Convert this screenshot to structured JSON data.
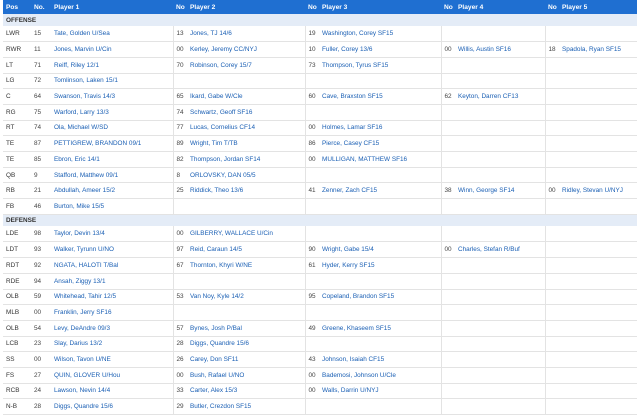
{
  "headers": [
    "Pos",
    "No.",
    "Player 1",
    "No",
    "Player 2",
    "No",
    "Player 3",
    "No",
    "Player 4",
    "No",
    "Player 5"
  ],
  "offense_label": "OFFENSE",
  "defense_label": "DEFENSE",
  "offense": [
    {
      "pos": "LWR",
      "n1": "15",
      "p1": "Tate, Golden U/Sea",
      "n2": "13",
      "p2": "Jones, TJ 14/6",
      "n3": "19",
      "p3": "Washington, Corey SF15",
      "n4": "",
      "p4": "",
      "n5": "",
      "p5": ""
    },
    {
      "pos": "RWR",
      "n1": "11",
      "p1": "Jones, Marvin U/Cin",
      "n2": "00",
      "p2": "Kerley, Jeremy CC/NYJ",
      "n3": "10",
      "p3": "Fuller, Corey 13/6",
      "n4": "00",
      "p4": "Willis, Austin SF16",
      "n5": "18",
      "p5": "Spadola, Ryan SF15"
    },
    {
      "pos": "LT",
      "n1": "71",
      "p1": "Reiff, Riley 12/1",
      "n2": "70",
      "p2": "Robinson, Corey 15/7",
      "n3": "73",
      "p3": "Thompson, Tyrus SF15",
      "n4": "",
      "p4": "",
      "n5": "",
      "p5": ""
    },
    {
      "pos": "LG",
      "n1": "72",
      "p1": "Tomlinson, Laken 15/1",
      "n2": "",
      "p2": "",
      "n3": "",
      "p3": "",
      "n4": "",
      "p4": "",
      "n5": "",
      "p5": ""
    },
    {
      "pos": "C",
      "n1": "64",
      "p1": "Swanson, Travis 14/3",
      "n2": "65",
      "p2": "Ikard, Gabe W/Cle",
      "n3": "60",
      "p3": "Cave, Braxston SF15",
      "n4": "62",
      "p4": "Keyton, Darren CF13",
      "n5": "",
      "p5": ""
    },
    {
      "pos": "RG",
      "n1": "75",
      "p1": "Warford, Larry 13/3",
      "n2": "74",
      "p2": "Schwartz, Geoff SF16",
      "n3": "",
      "p3": "",
      "n4": "",
      "p4": "",
      "n5": "",
      "p5": ""
    },
    {
      "pos": "RT",
      "n1": "74",
      "p1": "Ola, Michael W/SD",
      "n2": "77",
      "p2": "Lucas, Cornelius CF14",
      "n3": "00",
      "p3": "Holmes, Lamar SF16",
      "n4": "",
      "p4": "",
      "n5": "",
      "p5": ""
    },
    {
      "pos": "TE",
      "n1": "87",
      "p1": "PETTIGREW, BRANDON 09/1",
      "n2": "89",
      "p2": "Wright, Tim T/TB",
      "n3": "86",
      "p3": "Pierce, Casey CF15",
      "n4": "",
      "p4": "",
      "n5": "",
      "p5": ""
    },
    {
      "pos": "TE",
      "n1": "85",
      "p1": "Ebron, Eric 14/1",
      "n2": "82",
      "p2": "Thompson, Jordan SF14",
      "n3": "00",
      "p3": "MULLIGAN, MATTHEW SF16",
      "n4": "",
      "p4": "",
      "n5": "",
      "p5": ""
    },
    {
      "pos": "QB",
      "n1": "9",
      "p1": "Stafford, Matthew 09/1",
      "n2": "8",
      "p2": "ORLOVSKY, DAN 05/5",
      "n3": "",
      "p3": "",
      "n4": "",
      "p4": "",
      "n5": "",
      "p5": ""
    },
    {
      "pos": "RB",
      "n1": "21",
      "p1": "Abdullah, Ameer 15/2",
      "n2": "25",
      "p2": "Riddick, Theo 13/6",
      "n3": "41",
      "p3": "Zenner, Zach CF15",
      "n4": "38",
      "p4": "Winn, George SF14",
      "n5": "00",
      "p5": "Ridley, Stevan U/NYJ"
    },
    {
      "pos": "FB",
      "n1": "46",
      "p1": "Burton, Mike 15/5",
      "n2": "",
      "p2": "",
      "n3": "",
      "p3": "",
      "n4": "",
      "p4": "",
      "n5": "",
      "p5": ""
    }
  ],
  "defense": [
    {
      "pos": "LDE",
      "n1": "98",
      "p1": "Taylor, Devin 13/4",
      "n2": "00",
      "p2": "GILBERRY, WALLACE U/Cin",
      "n3": "",
      "p3": "",
      "n4": "",
      "p4": "",
      "n5": "",
      "p5": ""
    },
    {
      "pos": "LDT",
      "n1": "93",
      "p1": "Walker, Tyrunn U/NO",
      "n2": "97",
      "p2": "Reid, Caraun 14/5",
      "n3": "90",
      "p3": "Wright, Gabe 15/4",
      "n4": "00",
      "p4": "Charles, Stefan R/Buf",
      "n5": "",
      "p5": ""
    },
    {
      "pos": "RDT",
      "n1": "92",
      "p1": "NGATA, HALOTI T/Bal",
      "n2": "67",
      "p2": "Thornton, Khyri W/NE",
      "n3": "61",
      "p3": "Hyder, Kerry SF15",
      "n4": "",
      "p4": "",
      "n5": "",
      "p5": ""
    },
    {
      "pos": "RDE",
      "n1": "94",
      "p1": "Ansah, Ziggy 13/1",
      "n2": "",
      "p2": "",
      "n3": "",
      "p3": "",
      "n4": "",
      "p4": "",
      "n5": "",
      "p5": ""
    },
    {
      "pos": "OLB",
      "n1": "59",
      "p1": "Whitehead, Tahir 12/5",
      "n2": "53",
      "p2": "Van Noy, Kyle 14/2",
      "n3": "95",
      "p3": "Copeland, Brandon SF15",
      "n4": "",
      "p4": "",
      "n5": "",
      "p5": ""
    },
    {
      "pos": "MLB",
      "n1": "00",
      "p1": "Franklin, Jerry SF16",
      "n2": "",
      "p2": "",
      "n3": "",
      "p3": "",
      "n4": "",
      "p4": "",
      "n5": "",
      "p5": ""
    },
    {
      "pos": "OLB",
      "n1": "54",
      "p1": "Levy, DeAndre 09/3",
      "n2": "57",
      "p2": "Bynes, Josh P/Bal",
      "n3": "49",
      "p3": "Greene, Khaseem SF15",
      "n4": "",
      "p4": "",
      "n5": "",
      "p5": ""
    },
    {
      "pos": "LCB",
      "n1": "23",
      "p1": "Slay, Darius 13/2",
      "n2": "28",
      "p2": "Diggs, Quandre 15/6",
      "n3": "",
      "p3": "",
      "n4": "",
      "p4": "",
      "n5": "",
      "p5": ""
    },
    {
      "pos": "SS",
      "n1": "00",
      "p1": "Wilson, Tavon U/NE",
      "n2": "26",
      "p2": "Carey, Don SF11",
      "n3": "43",
      "p3": "Johnson, Isaiah CF15",
      "n4": "",
      "p4": "",
      "n5": "",
      "p5": ""
    },
    {
      "pos": "FS",
      "n1": "27",
      "p1": "QUIN, GLOVER U/Hou",
      "n2": "00",
      "p2": "Bush, Rafael U/NO",
      "n3": "00",
      "p3": "Bademosi, Johnson U/Cle",
      "n4": "",
      "p4": "",
      "n5": "",
      "p5": ""
    },
    {
      "pos": "RCB",
      "n1": "24",
      "p1": "Lawson, Nevin 14/4",
      "n2": "33",
      "p2": "Carter, Alex 15/3",
      "n3": "00",
      "p3": "Walls, Darrin U/NYJ",
      "n4": "",
      "p4": "",
      "n5": "",
      "p5": ""
    },
    {
      "pos": "N-B",
      "n1": "28",
      "p1": "Diggs, Quandre 15/6",
      "n2": "29",
      "p2": "Butler, Crezdon SF15",
      "n3": "",
      "p3": "",
      "n4": "",
      "p4": "",
      "n5": "",
      "p5": ""
    }
  ]
}
